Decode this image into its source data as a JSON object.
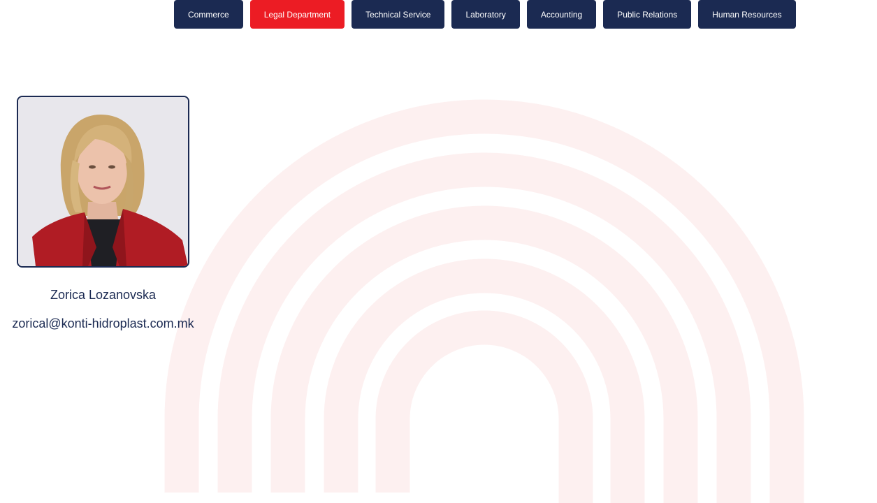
{
  "tabs": [
    {
      "label": "Commerce",
      "active": false
    },
    {
      "label": "Legal Department",
      "active": true
    },
    {
      "label": "Technical Service",
      "active": false
    },
    {
      "label": "Laboratory",
      "active": false
    },
    {
      "label": "Accounting",
      "active": false
    },
    {
      "label": "Public Relations",
      "active": false
    },
    {
      "label": "Human Resources",
      "active": false
    }
  ],
  "person": {
    "name": "Zorica Lozanovska",
    "email": "zorical@konti-hidroplast.com.mk",
    "photo_icon": "portrait-photo"
  },
  "colors": {
    "navy": "#1b2a52",
    "accent_red": "#ec1c24",
    "arch_tint": "#fdf0f0"
  }
}
